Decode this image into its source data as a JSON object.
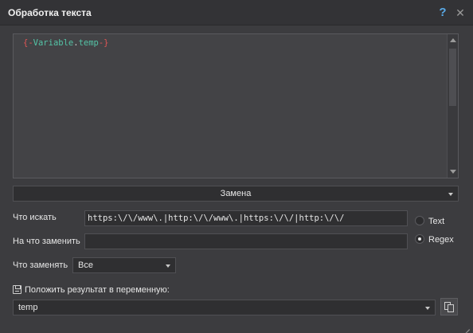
{
  "window": {
    "title": "Обработка текста",
    "help_label": "?",
    "close_label": "✕"
  },
  "editor": {
    "tokens": {
      "open": "{-",
      "variable": "Variable",
      "dot": ".",
      "name": "temp",
      "close": "-}"
    }
  },
  "mode": {
    "selected": "Замена"
  },
  "find": {
    "label": "Что искать",
    "value": "https:\\/\\/www\\.|http:\\/\\/www\\.|https:\\/\\/|http:\\/\\/"
  },
  "replace": {
    "label": "На что заменить",
    "value": ""
  },
  "match_type": {
    "options": [
      {
        "label": "Text",
        "selected": false
      },
      {
        "label": "Regex",
        "selected": true
      }
    ]
  },
  "scope": {
    "label": "Что заменять",
    "selected": "Все"
  },
  "result": {
    "label": "Положить результат в переменную:",
    "variable": "temp"
  },
  "icons": {
    "help": "help-icon",
    "close": "close-icon",
    "save": "floppy-disk-icon",
    "copy": "copy-icon",
    "resize": "resize-grip-icon"
  },
  "colors": {
    "background": "#3c3c3f",
    "titlebar": "#333336",
    "help_accent": "#59a9e6",
    "token_brace": "#e05555",
    "token_variable": "#54c3a6"
  }
}
